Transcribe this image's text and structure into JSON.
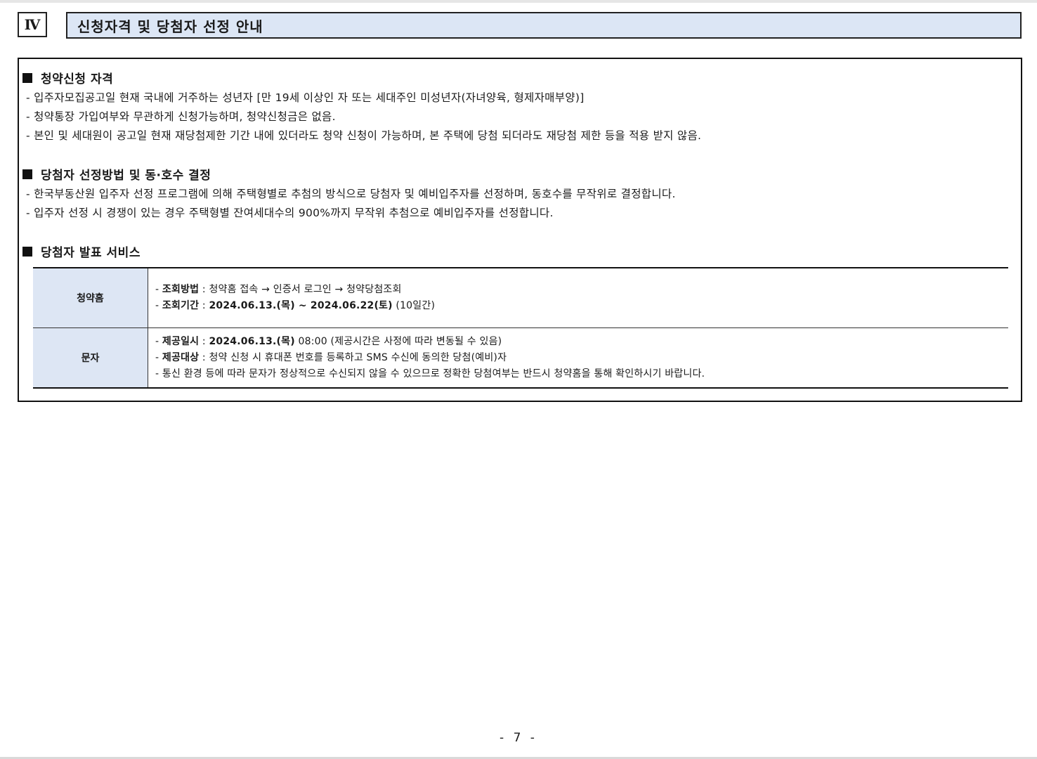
{
  "section": {
    "number": "Ⅳ",
    "title": "신청자격 및 당첨자 선정 안내"
  },
  "qualification": {
    "heading": "청약신청 자격",
    "lines": [
      "- 입주자모집공고일 현재 국내에 거주하는 성년자 [만 19세 이상인 자 또는 세대주인 미성년자(자녀양육, 형제자매부양)]",
      "- 청약통장 가입여부와 무관하게 신청가능하며, 청약신청금은 없음.",
      "- 본인 및 세대원이 공고일 현재 재당첨제한 기간 내에 있더라도 청약 신청이 가능하며, 본 주택에 당첨 되더라도 재당첨 제한 등을 적용 받지 않음."
    ]
  },
  "selection": {
    "heading": "당첨자 선정방법 및 동·호수 결정",
    "lines": [
      "- 한국부동산원 입주자 선정 프로그램에 의해 주택형별로 추첨의 방식으로 당첨자 및 예비입주자를 선정하며, 동호수를 무작위로 결정합니다.",
      "- 입주자 선정 시 경쟁이 있는 경우 주택형별 잔여세대수의 900%까지 무작위 추첨으로 예비입주자를 선정합니다."
    ]
  },
  "announcement": {
    "heading": "당첨자 발표 서비스",
    "home": {
      "label": "청약홈",
      "method_label": "조회방법",
      "method_value": "청약홈 접속 → 인증서 로그인 → 청약당첨조회",
      "period_label": "조회기간",
      "period_value": "2024.06.13.(목) ~ 2024.06.22(토)",
      "period_note": "(10일간)"
    },
    "sms": {
      "label": "문자",
      "time_label": "제공일시",
      "time_value": "2024.06.13.(목)",
      "time_note": "08:00 (제공시간은 사정에 따라 변동될 수 있음)",
      "target_label": "제공대상",
      "target_value": "청약 신청 시 휴대폰 번호를 등록하고 SMS 수신에 동의한 당첨(예비)자",
      "notice": "- 통신 환경 등에 따라 문자가 정상적으로 수신되지 않을 수 있으므로 정확한 당첨여부는 반드시 청약홈을 통해 확인하시기 바랍니다."
    }
  },
  "footer": {
    "page_number": "- 7 -"
  }
}
